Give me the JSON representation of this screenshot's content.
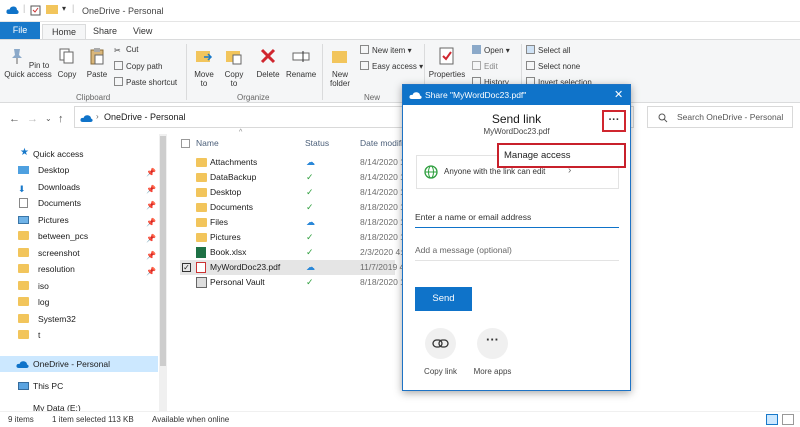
{
  "window": {
    "title": "OneDrive - Personal"
  },
  "ribbon_tabs": [
    "File",
    "Home",
    "Share",
    "View"
  ],
  "ribbon": {
    "clipboard": {
      "pin": "Pin to Quick access",
      "copy": "Copy",
      "paste": "Paste",
      "cut": "Cut",
      "copy_path": "Copy path",
      "paste_shortcut": "Paste shortcut",
      "group": "Clipboard"
    },
    "organize": {
      "move_to": "Move to",
      "copy_to": "Copy to",
      "delete": "Delete",
      "rename": "Rename",
      "group": "Organize"
    },
    "new": {
      "new_folder": "New folder",
      "new_item": "New item",
      "easy_access": "Easy access",
      "group": "New"
    },
    "open": {
      "properties": "Properties",
      "open": "Open",
      "edit": "Edit",
      "history": "History"
    },
    "select": {
      "select_all": "Select all",
      "select_none": "Select none",
      "invert": "Invert selection"
    }
  },
  "address": {
    "path": "OneDrive - Personal",
    "search_placeholder": "Search OneDrive - Personal"
  },
  "nav": {
    "quick_access": "Quick access",
    "items": [
      "Desktop",
      "Downloads",
      "Documents",
      "Pictures",
      "between_pcs",
      "screenshot",
      "resolution",
      "iso",
      "log",
      "System32",
      "t"
    ],
    "onedrive": "OneDrive - Personal",
    "this_pc": "This PC",
    "my_data": "My Data (E:)"
  },
  "columns": {
    "name": "Name",
    "status": "Status",
    "date": "Date modifi"
  },
  "files": [
    {
      "name": "Attachments",
      "status": "cloud",
      "date": "8/14/2020 1"
    },
    {
      "name": "DataBackup",
      "status": "synced",
      "date": "8/14/2020 1"
    },
    {
      "name": "Desktop",
      "status": "synced",
      "date": "8/14/2020 1"
    },
    {
      "name": "Documents",
      "status": "synced",
      "date": "8/18/2020 1"
    },
    {
      "name": "Files",
      "status": "cloud",
      "date": "8/18/2020 1"
    },
    {
      "name": "Pictures",
      "status": "synced",
      "date": "8/18/2020 1"
    },
    {
      "name": "Book.xlsx",
      "status": "synced",
      "date": "2/3/2020 4:"
    },
    {
      "name": "MyWordDoc23.pdf",
      "status": "cloud",
      "date": "11/7/2019 4"
    },
    {
      "name": "Personal Vault",
      "status": "synced",
      "date": "8/18/2020 1"
    }
  ],
  "statusbar": {
    "items": "9 items",
    "selected": "1 item selected  113 KB",
    "availability": "Available when online"
  },
  "share_dialog": {
    "title": "Share \"MyWordDoc23.pdf\"",
    "heading": "Send link",
    "filename": "MyWordDoc23.pdf",
    "more": "···",
    "manage_access": "Manage access",
    "permission": "Anyone with the link can edit",
    "email_placeholder": "Enter a name or email address",
    "message_placeholder": "Add a message (optional)",
    "send": "Send",
    "copy_link": "Copy link",
    "more_apps": "More apps"
  },
  "colors": {
    "accent": "#0f73c9",
    "highlight": "#d0262f",
    "folder": "#f2c55c",
    "sync_green": "#2e9f3e"
  }
}
